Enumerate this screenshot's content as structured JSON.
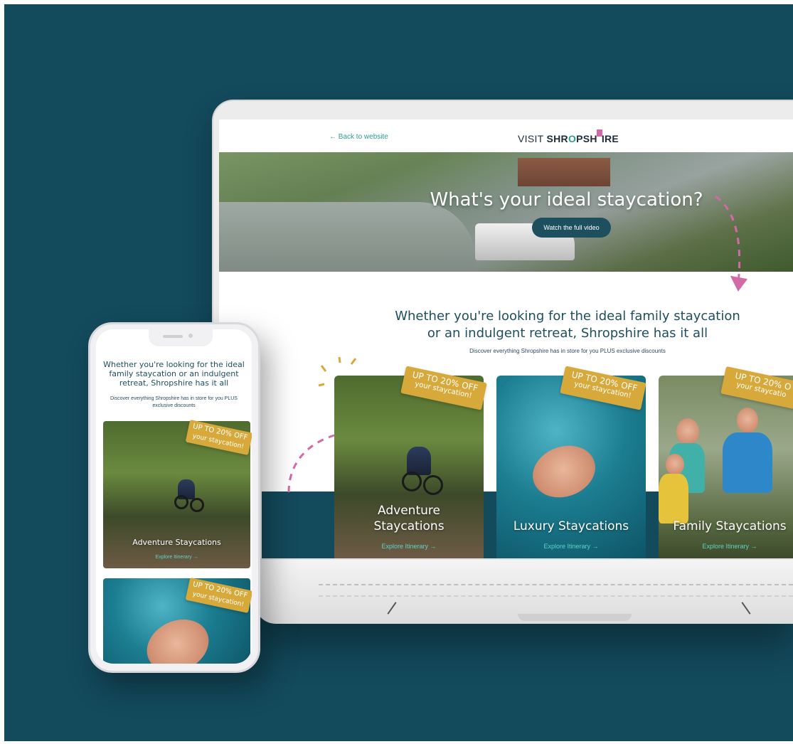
{
  "desktop": {
    "back_link": "← Back to website",
    "logo": {
      "prefix": "VISIT",
      "brand_start": "SHR",
      "brand_o": "O",
      "brand_mid": "PSH",
      "brand_end": "IRE"
    },
    "hero": {
      "title": "What's your ideal staycation?",
      "button": "Watch the full video"
    },
    "intro": {
      "title_line1": "Whether you're looking for the ideal family staycation",
      "title_line2": "or an indulgent retreat, Shropshire has it all",
      "subtitle": "Discover everything Shropshire has in store for you PLUS exclusive discounts"
    },
    "cards": [
      {
        "title_line1": "Adventure",
        "title_line2": "Staycations",
        "explore": "Explore Itinerary →",
        "ticket_line1": "UP TO 20% OFF",
        "ticket_line2": "your staycation!"
      },
      {
        "title": "Luxury Staycations",
        "explore": "Explore Itinerary →",
        "ticket_line1": "UP TO 20% OFF",
        "ticket_line2": "your staycation!"
      },
      {
        "title": "Family Staycations",
        "explore": "Explore Itinerary →",
        "ticket_line1": "UP TO 20% O",
        "ticket_line2": "your staycatio"
      }
    ]
  },
  "mobile": {
    "intro": {
      "title": "Whether you're looking for the ideal family staycation or an indulgent retreat, Shropshire has it all",
      "subtitle": "Discover everything Shropshire has in store for you PLUS exclusive discounts"
    },
    "cards": [
      {
        "title": "Adventure Staycations",
        "explore": "Explore Itinerary →",
        "ticket_line1": "UP TO 20% OFF",
        "ticket_line2": "your staycation!"
      },
      {
        "ticket_line1": "UP TO 20% OFF",
        "ticket_line2": "your staycation!"
      }
    ]
  },
  "colors": {
    "background": "#134a5c",
    "accent_gold": "#d7a93b",
    "accent_teal": "#5dd3c8",
    "accent_pink": "#d36aa8",
    "heading": "#1d4f5f"
  }
}
